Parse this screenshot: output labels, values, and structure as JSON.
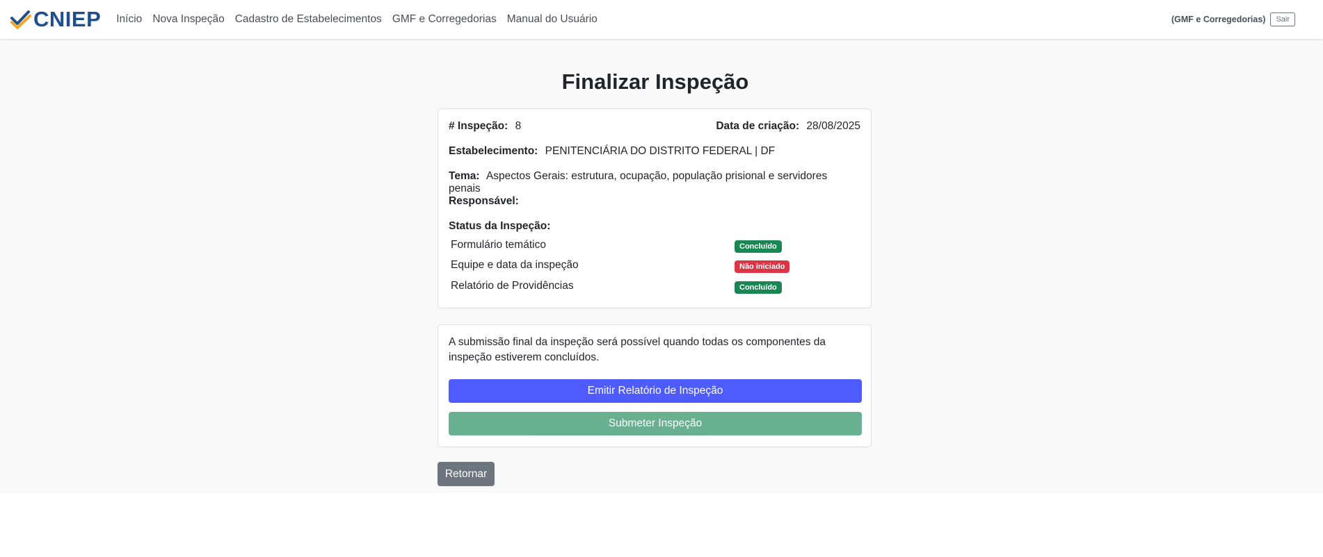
{
  "brand": {
    "name": "CNIEP"
  },
  "nav": {
    "items": [
      {
        "label": "Início"
      },
      {
        "label": "Nova Inspeção"
      },
      {
        "label": "Cadastro de Estabelecimentos"
      },
      {
        "label": "GMF e Corregedorias"
      },
      {
        "label": "Manual do Usuário"
      }
    ],
    "user_label": "(GMF e Corregedorias)",
    "logout_label": "Sair"
  },
  "page": {
    "title": "Finalizar Inspeção"
  },
  "inspection": {
    "id_label": "# Inspeção:",
    "id_value": "8",
    "date_label": "Data de criação:",
    "date_value": "28/08/2025",
    "establishment_label": "Estabelecimento:",
    "establishment_value": "PENITENCIÁRIA DO DISTRITO FEDERAL | DF",
    "theme_label": "Tema:",
    "theme_value": "Aspectos Gerais: estrutura, ocupação, população prisional e servidores penais",
    "responsible_label": "Responsável:",
    "status_label": "Status da Inspeção:",
    "status_items": [
      {
        "name": "Formulário temático",
        "status": "Concluído",
        "color": "#198754"
      },
      {
        "name": "Equipe e data da inspeção",
        "status": "Não iniciado",
        "color": "#dc3545"
      },
      {
        "name": "Relatório de Providências",
        "status": "Concluído",
        "color": "#198754"
      }
    ]
  },
  "submission": {
    "message": "A submissão final da inspeção será possível quando todas os componentes da inspeção estiverem concluídos.",
    "report_button": "Emitir Relatório de Inspeção",
    "submit_button": "Submeter Inspeção"
  },
  "back_button": "Retornar",
  "colors": {
    "brand": "#1f4e8c",
    "brand_accent": "#f5a623",
    "primary": "#4e5cff",
    "success": "#198754",
    "danger": "#dc3545",
    "secondary": "#6c757d"
  }
}
